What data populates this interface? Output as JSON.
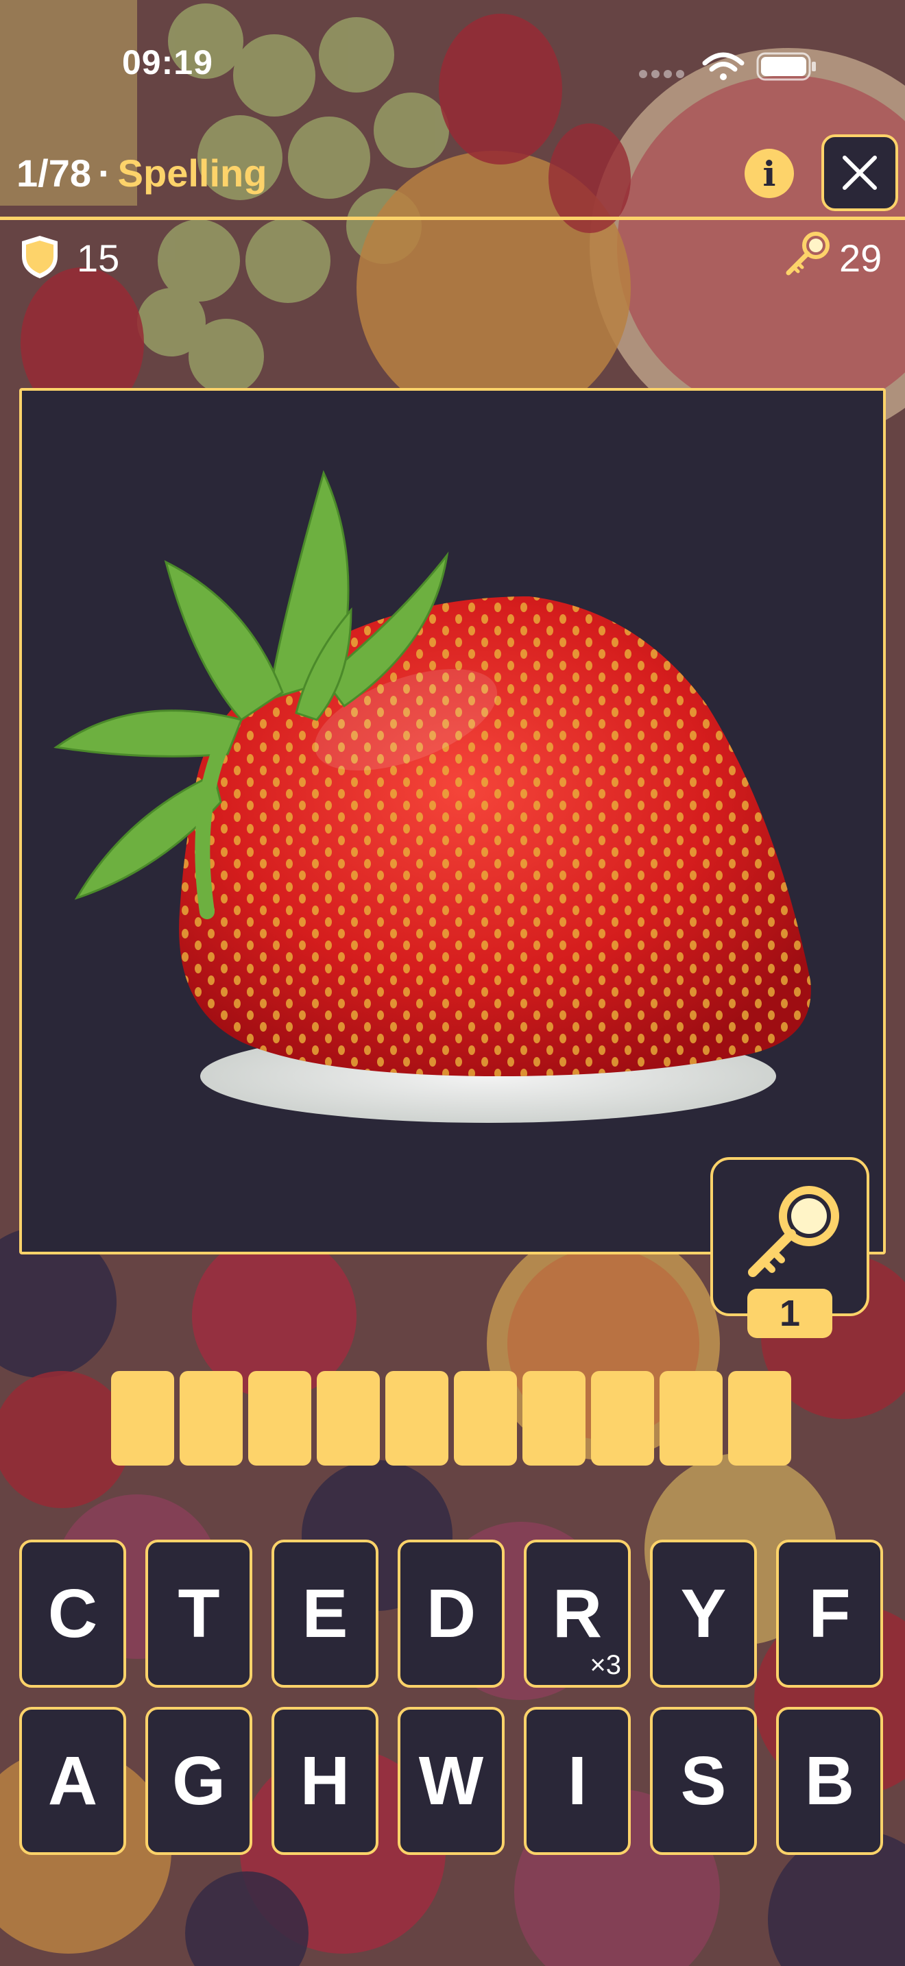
{
  "status_bar": {
    "time": "09:19",
    "icons": [
      "cellular-signal-icon",
      "wifi-icon",
      "battery-icon"
    ]
  },
  "header": {
    "progress": "1/78",
    "separator": "·",
    "mode": "Spelling",
    "info_icon": "info-icon",
    "info_glyph": "i",
    "close_icon": "close-icon"
  },
  "stats": {
    "shields": {
      "icon": "shield-icon",
      "value": "15"
    },
    "keys": {
      "icon": "magnifier-key-icon",
      "value": "29"
    }
  },
  "image": {
    "subject_icon": "strawberry-image"
  },
  "hint": {
    "icon": "magnifier-key-icon",
    "count": "1"
  },
  "answer": {
    "slot_count": 10
  },
  "keyboard": {
    "rows": [
      [
        {
          "letter": "C",
          "mult": ""
        },
        {
          "letter": "T",
          "mult": ""
        },
        {
          "letter": "E",
          "mult": ""
        },
        {
          "letter": "D",
          "mult": ""
        },
        {
          "letter": "R",
          "mult": "×3"
        },
        {
          "letter": "Y",
          "mult": ""
        },
        {
          "letter": "F",
          "mult": ""
        }
      ],
      [
        {
          "letter": "A",
          "mult": ""
        },
        {
          "letter": "G",
          "mult": ""
        },
        {
          "letter": "H",
          "mult": ""
        },
        {
          "letter": "W",
          "mult": ""
        },
        {
          "letter": "I",
          "mult": ""
        },
        {
          "letter": "S",
          "mult": ""
        },
        {
          "letter": "B",
          "mult": ""
        }
      ]
    ]
  },
  "colors": {
    "accent": "#fdd36a",
    "panel": "#2a2738",
    "text": "#ffffff"
  }
}
